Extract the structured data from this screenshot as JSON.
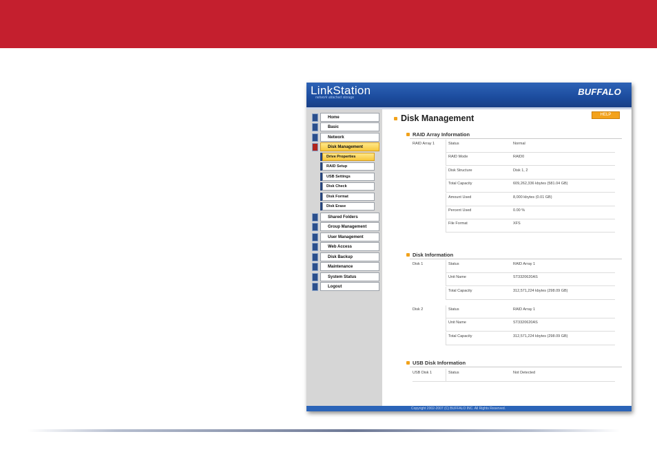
{
  "window": {
    "logo": "LinkStation",
    "logo_subtitle": "network attached storage",
    "brand": "BUFFALO",
    "footer": "Copyright 2002-2007 (C) BUFFALO INC. All Rights Reserved."
  },
  "sidebar": {
    "items": [
      {
        "label": "Home",
        "icon": "home-icon"
      },
      {
        "label": "Basic",
        "icon": "basic-icon"
      },
      {
        "label": "Network",
        "icon": "network-icon"
      },
      {
        "label": "Disk Management",
        "icon": "disk-icon",
        "active": true
      },
      {
        "label": "Shared Folders",
        "icon": "folder-icon"
      },
      {
        "label": "Group Management",
        "icon": "group-icon"
      },
      {
        "label": "User Management",
        "icon": "user-icon"
      },
      {
        "label": "Web Access",
        "icon": "web-icon"
      },
      {
        "label": "Disk Backup",
        "icon": "backup-icon"
      },
      {
        "label": "Maintenance",
        "icon": "maintenance-icon"
      },
      {
        "label": "System Status",
        "icon": "status-icon"
      },
      {
        "label": "Logout",
        "icon": "logout-icon"
      }
    ],
    "subitems": [
      {
        "label": "Drive Properties",
        "active": true
      },
      {
        "label": "RAID Setup"
      },
      {
        "label": "USB Settings"
      },
      {
        "label": "Disk Check"
      },
      {
        "label": "Disk Format"
      },
      {
        "label": "Disk Erase"
      }
    ]
  },
  "main": {
    "title": "Disk Management",
    "help_label": "HELP",
    "raid": {
      "title": "RAID Array Information",
      "group": "RAID Array 1",
      "rows": [
        {
          "label": "Status",
          "value": "Normal"
        },
        {
          "label": "RAID Mode",
          "value": "RAID0"
        },
        {
          "label": "Disk Structure",
          "value": "Disk 1, 2"
        },
        {
          "label": "Total Capacity",
          "value": "609,262,336 kbytes (581.04 GB)"
        },
        {
          "label": "Amount Used",
          "value": "8,000 kbytes (0.01 GB)"
        },
        {
          "label": "Percent Used",
          "value": "0.00 %"
        },
        {
          "label": "File Format",
          "value": "XFS"
        }
      ]
    },
    "disk": {
      "title": "Disk Information",
      "disks": [
        {
          "name": "Disk 1",
          "rows": [
            {
              "label": "Status",
              "value": "RAID Array 1"
            },
            {
              "label": "Unit Name",
              "value": "ST3320620AS"
            },
            {
              "label": "Total Capacity",
              "value": "312,571,224 kbytes (298.09 GB)"
            }
          ]
        },
        {
          "name": "Disk 2",
          "rows": [
            {
              "label": "Status",
              "value": "RAID Array 1"
            },
            {
              "label": "Unit Name",
              "value": "ST3320620AS"
            },
            {
              "label": "Total Capacity",
              "value": "312,571,224 kbytes (298.09 GB)"
            }
          ]
        }
      ]
    },
    "usb": {
      "title": "USB Disk Information",
      "rows": [
        {
          "name": "USB Disk 1",
          "label": "Status",
          "value": "Not Detected"
        }
      ]
    }
  },
  "colors": {
    "top_band": "#c41f2e",
    "header_blue": "#1c4c9e",
    "accent_orange": "#f3a21b"
  }
}
